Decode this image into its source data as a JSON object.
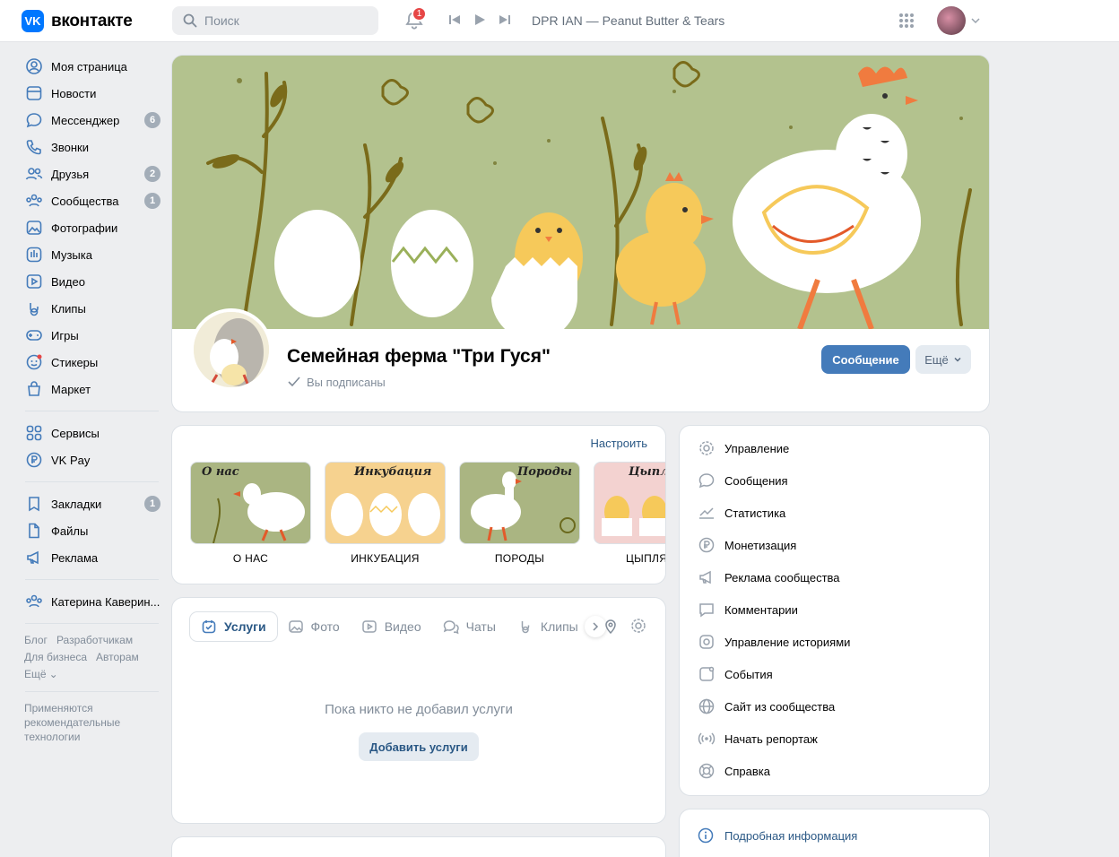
{
  "header": {
    "logo_text": "вконтакте",
    "search_placeholder": "Поиск",
    "notifications_count": "1",
    "now_playing": "DPR IAN — Peanut Butter & Tears"
  },
  "sidebar": {
    "items": [
      {
        "label": "Моя страница",
        "icon": "profile-icon"
      },
      {
        "label": "Новости",
        "icon": "news-icon"
      },
      {
        "label": "Мессенджер",
        "icon": "messenger-icon",
        "badge": "6"
      },
      {
        "label": "Звонки",
        "icon": "phone-icon"
      },
      {
        "label": "Друзья",
        "icon": "friends-icon",
        "badge": "2"
      },
      {
        "label": "Сообщества",
        "icon": "communities-icon",
        "badge": "1"
      },
      {
        "label": "Фотографии",
        "icon": "photos-icon"
      },
      {
        "label": "Музыка",
        "icon": "music-icon"
      },
      {
        "label": "Видео",
        "icon": "video-icon"
      },
      {
        "label": "Клипы",
        "icon": "clips-icon"
      },
      {
        "label": "Игры",
        "icon": "games-icon"
      },
      {
        "label": "Стикеры",
        "icon": "stickers-icon"
      },
      {
        "label": "Маркет",
        "icon": "market-icon"
      }
    ],
    "items2": [
      {
        "label": "Сервисы",
        "icon": "services-icon"
      },
      {
        "label": "VK Pay",
        "icon": "vkpay-icon"
      }
    ],
    "items3": [
      {
        "label": "Закладки",
        "icon": "bookmark-icon",
        "badge": "1"
      },
      {
        "label": "Файлы",
        "icon": "files-icon"
      },
      {
        "label": "Реклама",
        "icon": "ads-icon"
      }
    ],
    "items4": [
      {
        "label": "Катерина Каверин...",
        "icon": "group-icon"
      }
    ],
    "footer_links": [
      "Блог",
      "Разработчикам",
      "Для бизнеса",
      "Авторам",
      "Ещё"
    ],
    "footer_note": "Применяются рекомендательные технологии"
  },
  "group": {
    "title": "Семейная ферма \"Три Гуся\"",
    "subscribed_label": "Вы подписаны",
    "message_button": "Сообщение",
    "more_button": "Ещё"
  },
  "articles": {
    "setup_label": "Настроить",
    "items": [
      {
        "caption": "О нас",
        "label": "О НАС",
        "bg": "#aab582"
      },
      {
        "caption": "Инкубация",
        "label": "ИНКУБАЦИЯ",
        "bg": "#f6d28f"
      },
      {
        "caption": "Породы",
        "label": "ПОРОДЫ",
        "bg": "#aab582"
      },
      {
        "caption": "Цыпля",
        "label": "ЦЫПЛЯ",
        "bg": "#f3d2d0"
      }
    ]
  },
  "tabs": {
    "items": [
      {
        "label": "Услуги",
        "icon": "services-tab-icon",
        "active": true
      },
      {
        "label": "Фото",
        "icon": "photo-tab-icon"
      },
      {
        "label": "Видео",
        "icon": "video-tab-icon"
      },
      {
        "label": "Чаты",
        "icon": "chats-tab-icon"
      },
      {
        "label": "Клипы",
        "icon": "clips-tab-icon"
      }
    ],
    "empty_text": "Пока никто не добавил услуги",
    "add_button": "Добавить услуги"
  },
  "manage": {
    "items": [
      {
        "label": "Управление",
        "icon": "gear-icon"
      },
      {
        "label": "Сообщения",
        "icon": "message-icon"
      },
      {
        "label": "Статистика",
        "icon": "stats-icon"
      },
      {
        "label": "Монетизация",
        "icon": "ruble-icon"
      },
      {
        "label": "Реклама сообщества",
        "icon": "megaphone-icon"
      },
      {
        "label": "Комментарии",
        "icon": "comment-icon"
      },
      {
        "label": "Управление историями",
        "icon": "stories-icon"
      },
      {
        "label": "События",
        "icon": "events-icon"
      },
      {
        "label": "Сайт из сообщества",
        "icon": "globe-icon"
      },
      {
        "label": "Начать репортаж",
        "icon": "broadcast-icon"
      },
      {
        "label": "Справка",
        "icon": "help-icon"
      }
    ],
    "info_link": "Подробная информация"
  },
  "colors": {
    "accent": "#447bba",
    "link": "#2a5885",
    "cover_bg": "#b3c28e"
  }
}
